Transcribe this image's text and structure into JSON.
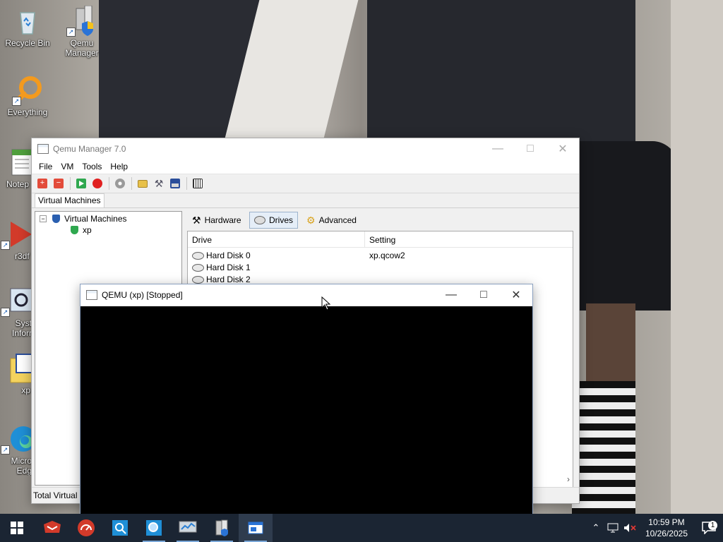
{
  "desktop": {
    "icons": [
      {
        "label": "Recycle Bin"
      },
      {
        "label": "Qemu Manager"
      },
      {
        "label": "Everything"
      },
      {
        "label": "Notep"
      },
      {
        "label": "r3df"
      },
      {
        "label": "Syst Inforr"
      },
      {
        "label": "xp"
      },
      {
        "label": "Micro Edg"
      }
    ]
  },
  "manager": {
    "title": "Qemu Manager 7.0",
    "menu": [
      "File",
      "VM",
      "Tools",
      "Help"
    ],
    "toolbar_icons": [
      "add-vm-icon",
      "remove-vm-icon",
      "start-vm-icon",
      "stop-vm-icon",
      "cd-icon",
      "open-folder-icon",
      "settings-icon",
      "save-icon",
      "options-icon"
    ],
    "tab_label": "Virtual Machines",
    "tree": {
      "root": "Virtual Machines",
      "child": "xp"
    },
    "right_tabs": [
      "Hardware",
      "Drives",
      "Advanced"
    ],
    "selected_tab": "Drives",
    "columns": [
      "Drive",
      "Setting"
    ],
    "rows": [
      {
        "drive": "Hard Disk 0",
        "setting": "xp.qcow2"
      },
      {
        "drive": "Hard Disk 1",
        "setting": ""
      },
      {
        "drive": "Hard Disk 2",
        "setting": ""
      }
    ],
    "status_text": "Total Virtual I"
  },
  "qemu_window": {
    "title": "QEMU (xp) [Stopped]"
  },
  "taskbar": {
    "time": "10:59 PM",
    "date": "10/26/2025",
    "notification_count": "1"
  },
  "colors": {
    "taskbar": "#1b2533",
    "accent": "#0078d7",
    "stop_red": "#e02020",
    "start_green": "#2fa84f"
  }
}
